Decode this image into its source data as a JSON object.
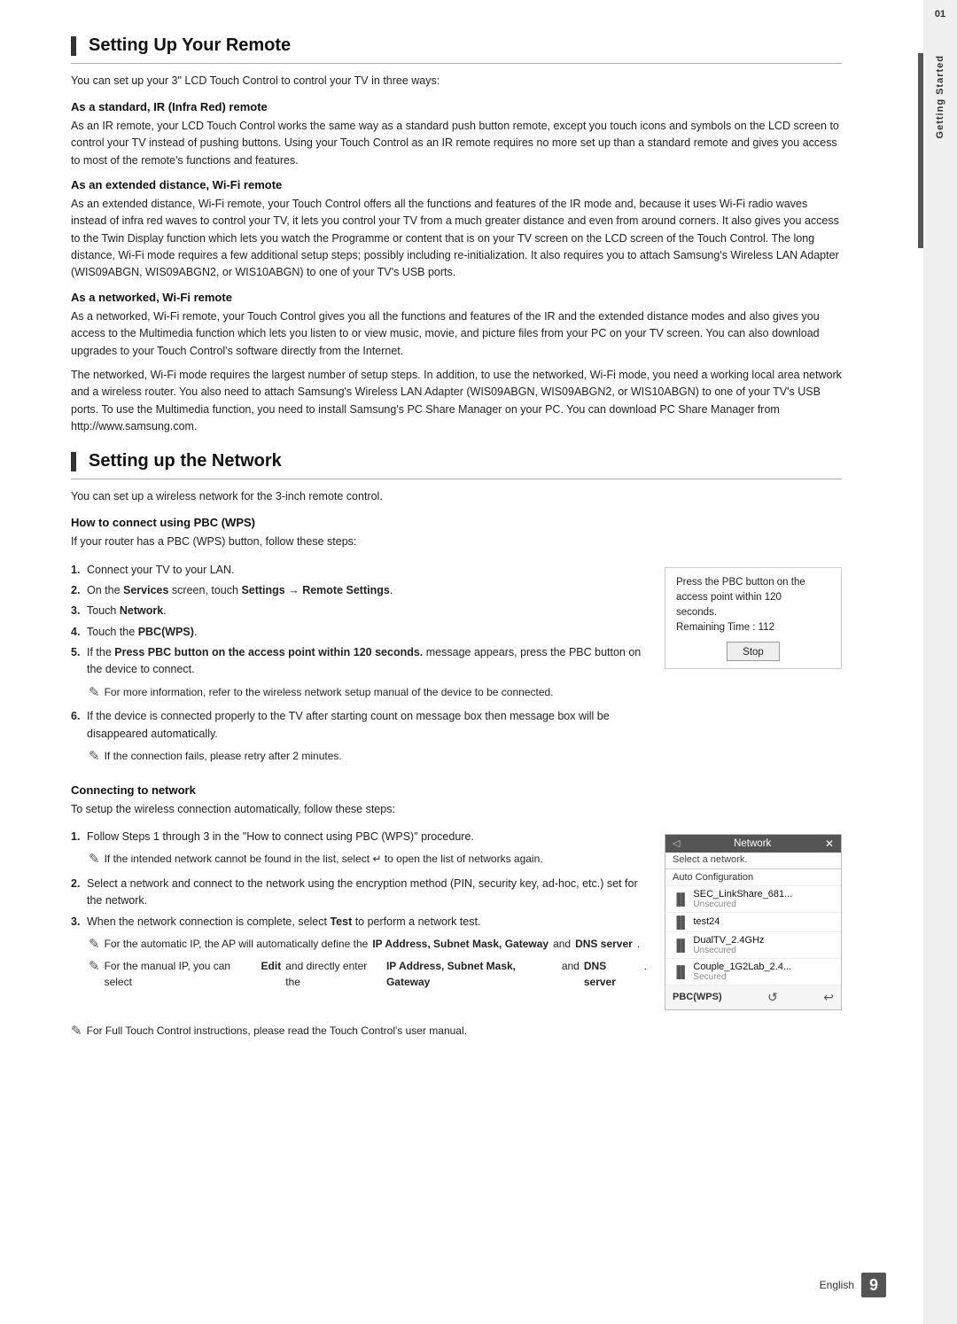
{
  "page": {
    "language": "English",
    "page_number": "9",
    "side_label": "Getting Started",
    "side_number": "01"
  },
  "section1": {
    "title": "Setting Up Your Remote",
    "intro": "You can set up your 3\" LCD Touch Control to control your TV in three ways:",
    "subsections": [
      {
        "title": "As a standard, IR (Infra Red) remote",
        "body": "As an IR remote, your LCD Touch Control works the same way as a standard push button remote, except you touch icons and symbols on the LCD screen to control your TV instead of pushing buttons. Using your Touch Control as an IR remote requires no more set up than a standard remote and gives you access to most of the remote's functions and features."
      },
      {
        "title": "As an extended distance, Wi-Fi remote",
        "body": "As an extended distance, Wi-Fi remote, your Touch Control offers all the functions and features of the IR mode and, because it uses Wi-Fi radio waves instead of infra red waves to control your TV, it lets you control your TV from a much greater distance and even from around corners. It also gives you access to the Twin Display function which lets you watch the Programme or content that is on your TV screen on the LCD screen of the Touch Control. The long distance, Wi-Fi mode requires a few additional setup steps; possibly including re-initialization. It also requires you to attach Samsung's Wireless LAN Adapter (WIS09ABGN, WIS09ABGN2, or WIS10ABGN) to one of your TV's USB ports."
      },
      {
        "title": "As a networked, Wi-Fi remote",
        "body1": "As a networked, Wi-Fi remote, your Touch Control gives you all the functions and features of the IR and the extended distance modes and also gives you access to the Multimedia function which lets you listen to or view music, movie, and picture files from your PC on your TV screen. You can also download upgrades to your Touch Control's software directly from the Internet.",
        "body2": "The networked, Wi-Fi mode requires the largest number of setup steps. In addition, to use the networked, Wi-Fi mode, you need a working local area network and a wireless router. You also need to attach Samsung's Wireless LAN Adapter (WIS09ABGN, WIS09ABGN2, or WIS10ABGN) to one of your TV's USB ports. To use the Multimedia function, you need to install Samsung's PC Share Manager on your PC. You can download PC Share Manager from http://www.samsung.com."
      }
    ]
  },
  "section2": {
    "title": "Setting up the Network",
    "intro": "You can set up a wireless network for the 3-inch remote control.",
    "subsection_pbc": {
      "title": "How to connect using PBC (WPS)",
      "intro": "If your router has a PBC (WPS) button, follow these steps:",
      "steps": [
        "Connect your TV to your LAN.",
        "On the Services screen, touch Settings → Remote Settings.",
        "Touch Network.",
        "Touch the PBC(WPS).",
        "If the Press PBC button on the access point within 120 seconds. message appears, press the PBC button on the device to connect.",
        "If the device is connected properly to the TV after starting count on message box then message box will be disappeared automatically."
      ],
      "note1": "For more information, refer to the wireless network setup manual of the device to be connected.",
      "note2": "If the connection fails, please retry after 2 minutes.",
      "pbc_box": {
        "line1": "Press the PBC button on the",
        "line2": "access point within 120",
        "line3": "seconds.",
        "line4": "Remaining Time : 112",
        "stop_label": "Stop"
      }
    },
    "subsection_connect": {
      "title": "Connecting to network",
      "intro": "To setup the wireless connection automatically, follow these steps:",
      "steps": [
        "Follow Steps 1 through 3 in the \"How to connect using PBC (WPS)\" procedure.",
        "Select a network and connect to the network using the encryption method (PIN, security key, ad-hoc, etc.) set for the network.",
        "When the network connection is complete, select Test to perform a network test."
      ],
      "note1": "If the intended network cannot be found in the list, select ↵ to open the list of networks again.",
      "note2": "For the automatic IP, the AP will automatically define the IP Address, Subnet Mask, Gateway and DNS server.",
      "note3": "For the manual IP, you can select Edit and directly enter the IP Address, Subnet Mask, Gateway and DNS server.",
      "network_box": {
        "header": "Network",
        "subtitle": "Select a network.",
        "auto": "Auto Configuration",
        "items": [
          {
            "name": "SEC_LinkShare_681...",
            "status": "Unsecured"
          },
          {
            "name": "test24",
            "status": ""
          },
          {
            "name": "DualTV_2.4GHz",
            "status": "Unsecured"
          },
          {
            "name": "Couple_1G2Lab_2.4...",
            "status": "Secured"
          }
        ],
        "pbc_label": "PBC(WPS)"
      }
    },
    "footer_note": "For Full Touch Control instructions, please read the Touch Control's user manual."
  }
}
